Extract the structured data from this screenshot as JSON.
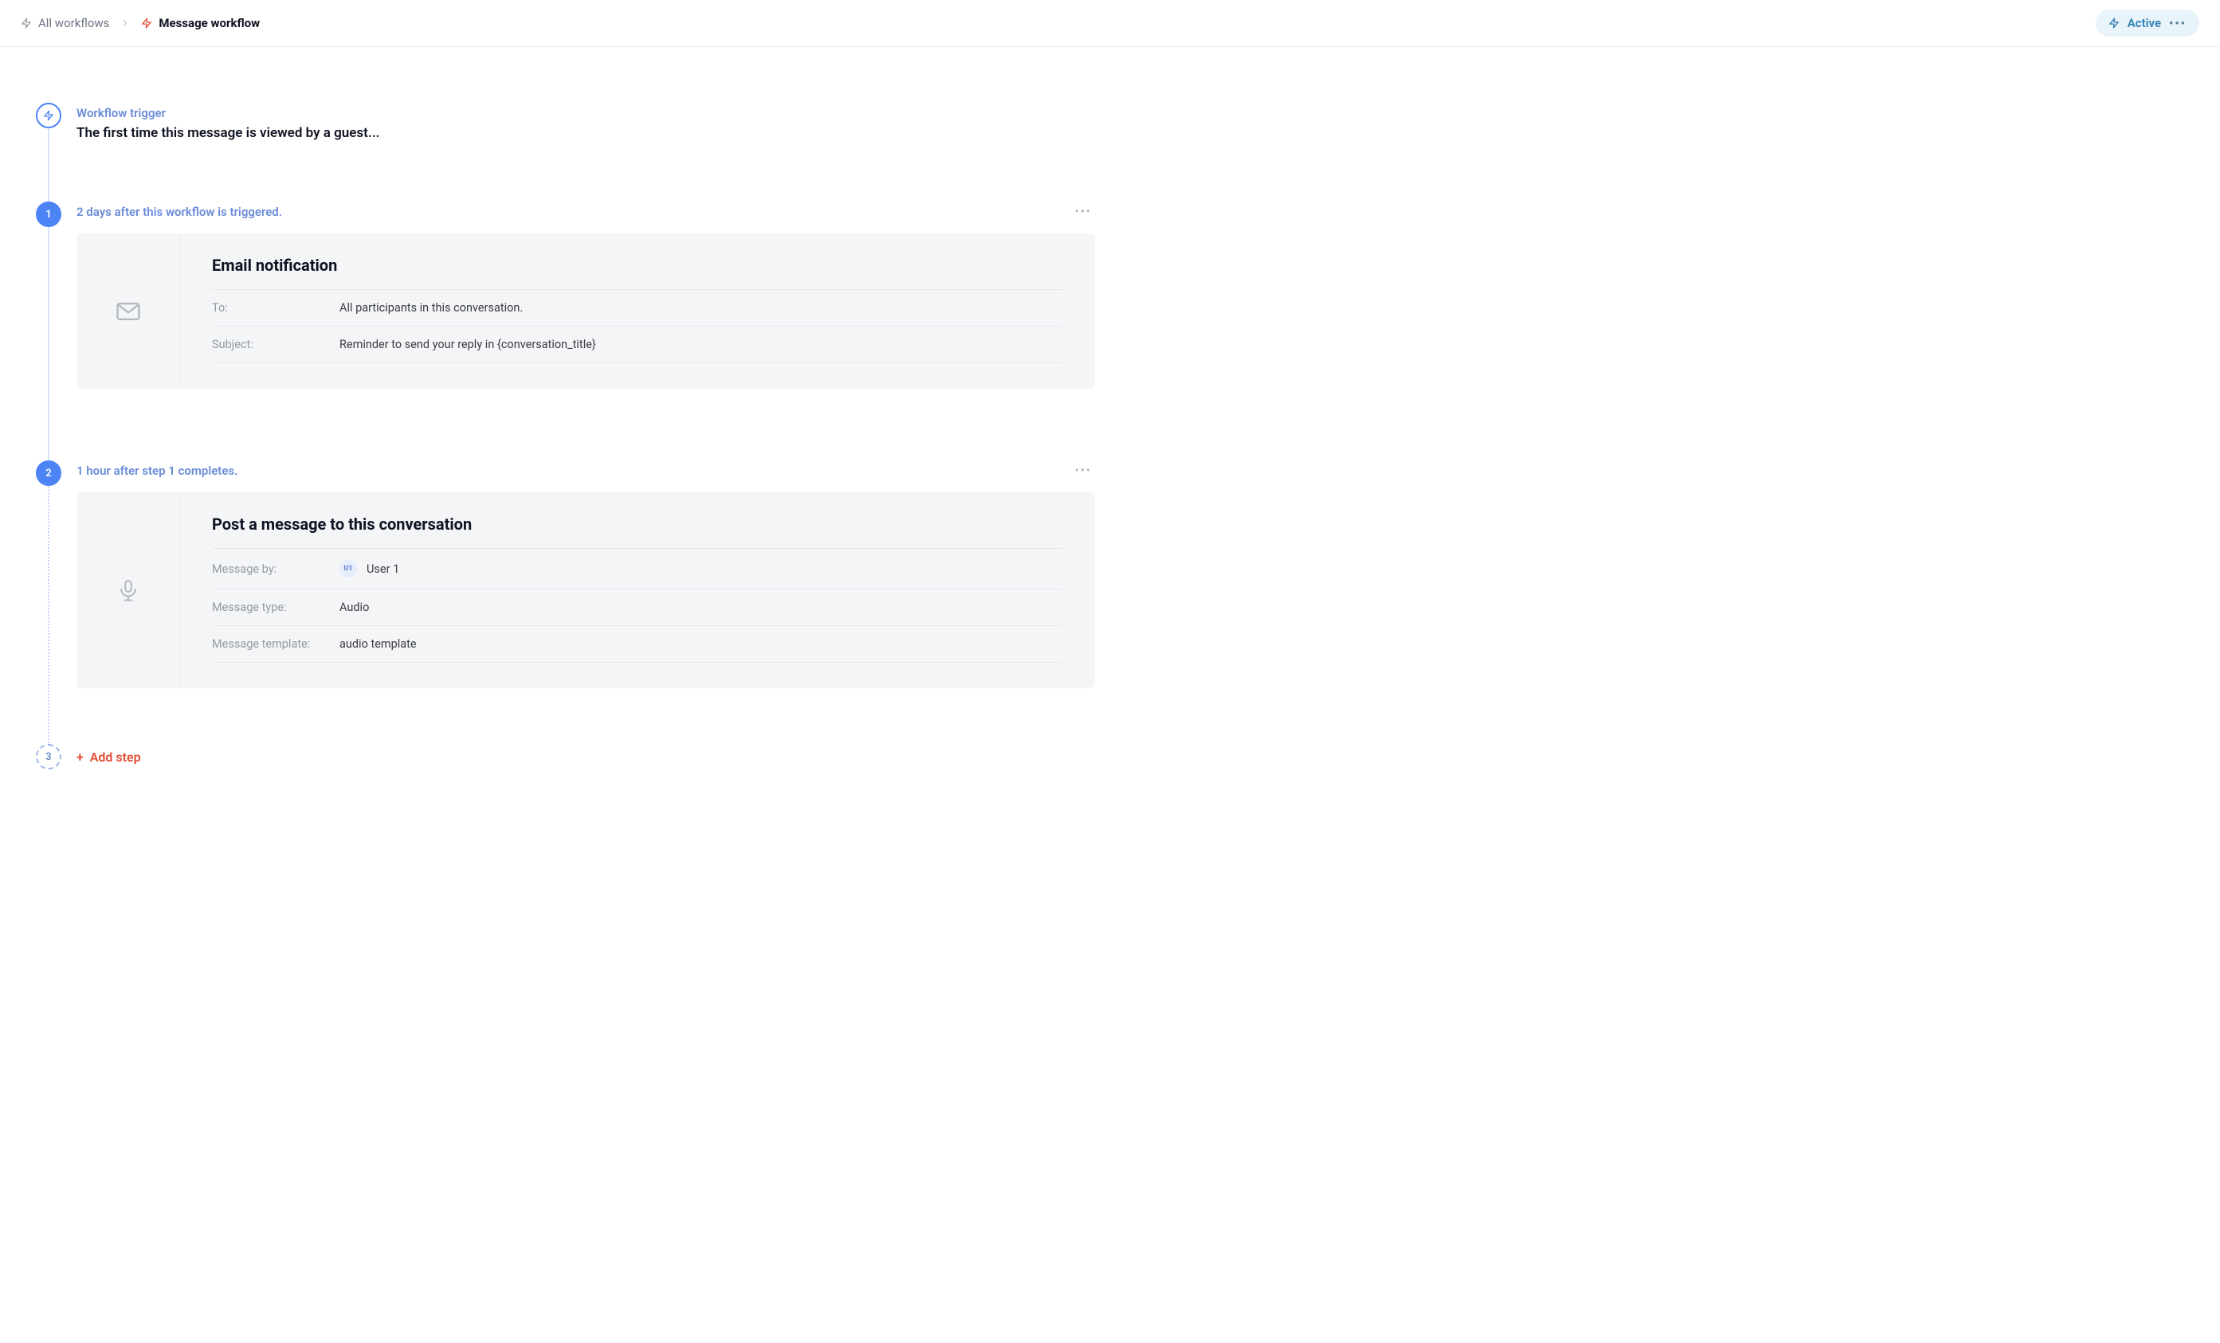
{
  "breadcrumb": {
    "root": "All workflows",
    "current": "Message workflow"
  },
  "status": {
    "label": "Active"
  },
  "trigger": {
    "label": "Workflow trigger",
    "description": "The first time this message is viewed by a guest..."
  },
  "steps": [
    {
      "number": "1",
      "timing": "2 days after this workflow is triggered.",
      "card": {
        "title": "Email notification",
        "fields": [
          {
            "label": "To:",
            "value": "All participants in this conversation."
          },
          {
            "label": "Subject:",
            "value": "Reminder to send your reply in {conversation_title}"
          }
        ]
      }
    },
    {
      "number": "2",
      "timing": "1 hour after step 1 completes.",
      "card": {
        "title": "Post a message to this conversation",
        "fields": [
          {
            "label": "Message by:",
            "value": "User 1",
            "userBadge": "U1"
          },
          {
            "label": "Message type:",
            "value": "Audio"
          },
          {
            "label": "Message template:",
            "value": "audio template"
          }
        ]
      }
    }
  ],
  "addStep": {
    "number": "3",
    "label": "Add step"
  }
}
